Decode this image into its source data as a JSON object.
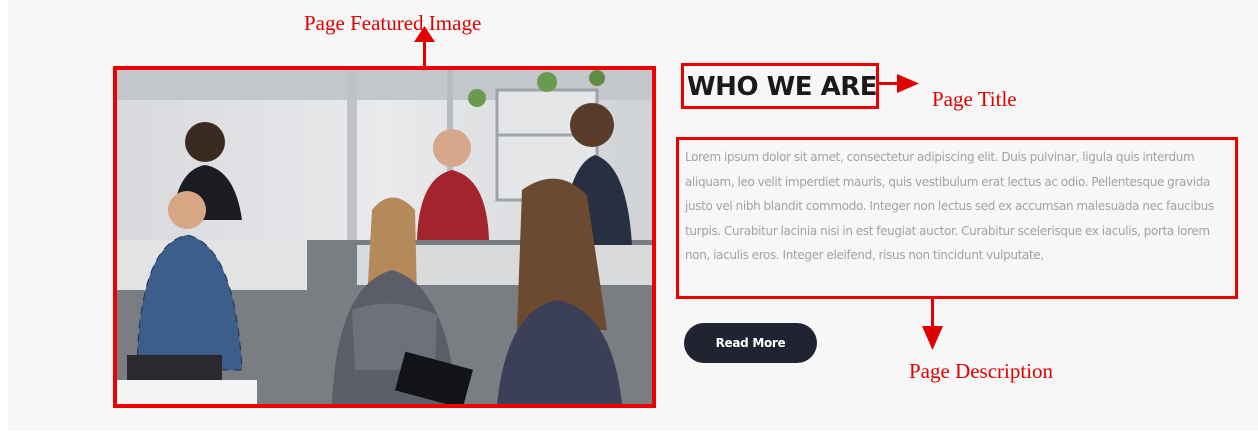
{
  "annotations": {
    "featured_image_label": "Page Featured Image",
    "title_label": "Page Title",
    "description_label": "Page Description",
    "color": "#ee0000"
  },
  "featured_image": {
    "icon": "team-meeting-photo"
  },
  "page": {
    "title": "WHO WE ARE",
    "description": "Lorem ipsum dolor sit amet, consectetur adipiscing elit. Duis pulvinar, ligula quis interdum aliquam, leo velit imperdiet mauris, quis vestibulum erat lectus ac odio. Pellentesque gravida justo vel nibh blandit commodo. Integer non lectus sed ex accumsan malesuada nec faucibus turpis. Curabitur lacinia nisi in est feugiat auctor. Curabitur scelerisque ex iaculis, porta lorem non, iaculis eros. Integer eleifend, risus non tincidunt vulputate,",
    "read_more_label": "Read More",
    "button_color": "#1f2430"
  }
}
